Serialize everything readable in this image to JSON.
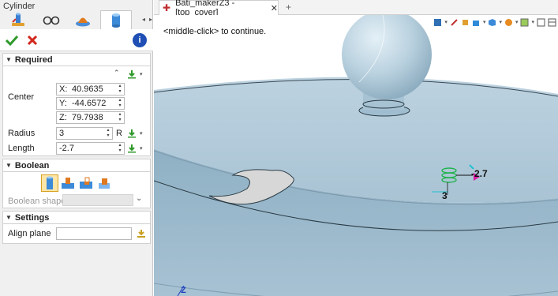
{
  "panel": {
    "title": "Cylinder",
    "tabs": [
      "cylinder-tool-icon",
      "glasses-icon",
      "display-icon",
      "cylinder-icon"
    ]
  },
  "required": {
    "header": "Required",
    "center_label": "Center",
    "center": {
      "x_label": "X:",
      "x": "40.9635",
      "y_label": "Y:",
      "y": "-44.6572",
      "z_label": "Z:",
      "z": "79.7938"
    },
    "radius_label": "Radius",
    "radius": "3",
    "radius_suffix": "R",
    "length_label": "Length",
    "length": "-2.7"
  },
  "boolean": {
    "header": "Boolean",
    "shapes_label": "Boolean shapes",
    "ops": [
      "base-icon",
      "add-icon",
      "remove-icon",
      "intersect-icon"
    ]
  },
  "settings": {
    "header": "Settings",
    "align_plane_label": "Align plane",
    "align_plane_value": ""
  },
  "document": {
    "tab_title": "Bati_makerZ3 - [top_cover]",
    "tab_close": "✕",
    "new_tab": "+"
  },
  "viewport": {
    "prompt": "<middle-click> to continue.",
    "length_tag": "-2.7",
    "radius_tag": "3",
    "axis_z": "Z",
    "colors": {
      "surface": "#b7cfdd",
      "edge": "#2a3a44",
      "accent_green": "#1fb34a",
      "accent_magenta": "#d81aa0",
      "accent_cyan": "#20c0d0"
    }
  }
}
